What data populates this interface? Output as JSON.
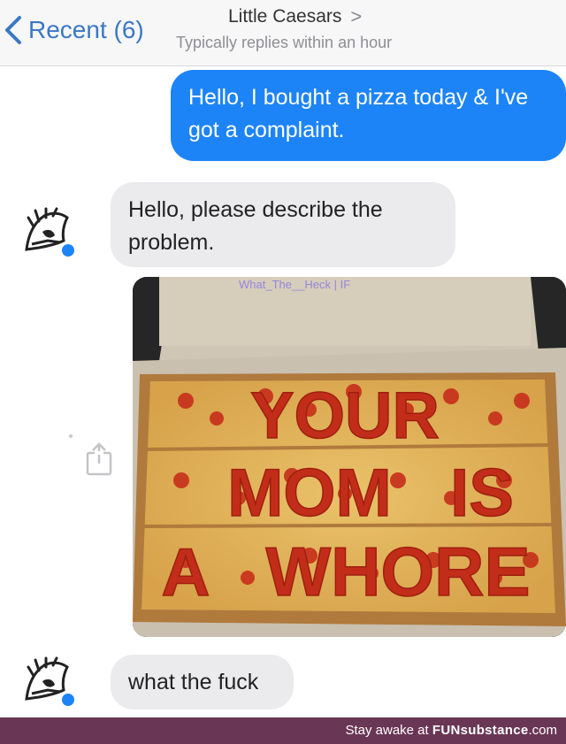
{
  "header": {
    "back_label": "Recent (6)",
    "contact_name": "Little Caesars",
    "chevron": ">",
    "status": "Typically replies within an hour"
  },
  "messages": [
    {
      "direction": "outgoing",
      "text": "Hello, I bought a pizza today & I've got a complaint."
    },
    {
      "direction": "incoming",
      "text": "Hello, please describe the problem."
    },
    {
      "direction": "incoming",
      "type": "image",
      "description": "pizza-photo"
    },
    {
      "direction": "incoming",
      "text": "what the fuck"
    }
  ],
  "photo": {
    "pizza_words": [
      "YOUR",
      "MOM",
      "IS",
      "A",
      "WHORE"
    ],
    "watermark": "What_The__Heck | IF"
  },
  "footer": {
    "prefix": "Stay awake at",
    "brand_bold": "FUNsubstance",
    "brand_suffix": ".com"
  },
  "colors": {
    "outgoing_bubble": "#1d84f7",
    "incoming_bubble": "#ebebee",
    "footer_bg": "#6a3655",
    "link_blue": "#3a78c4"
  }
}
